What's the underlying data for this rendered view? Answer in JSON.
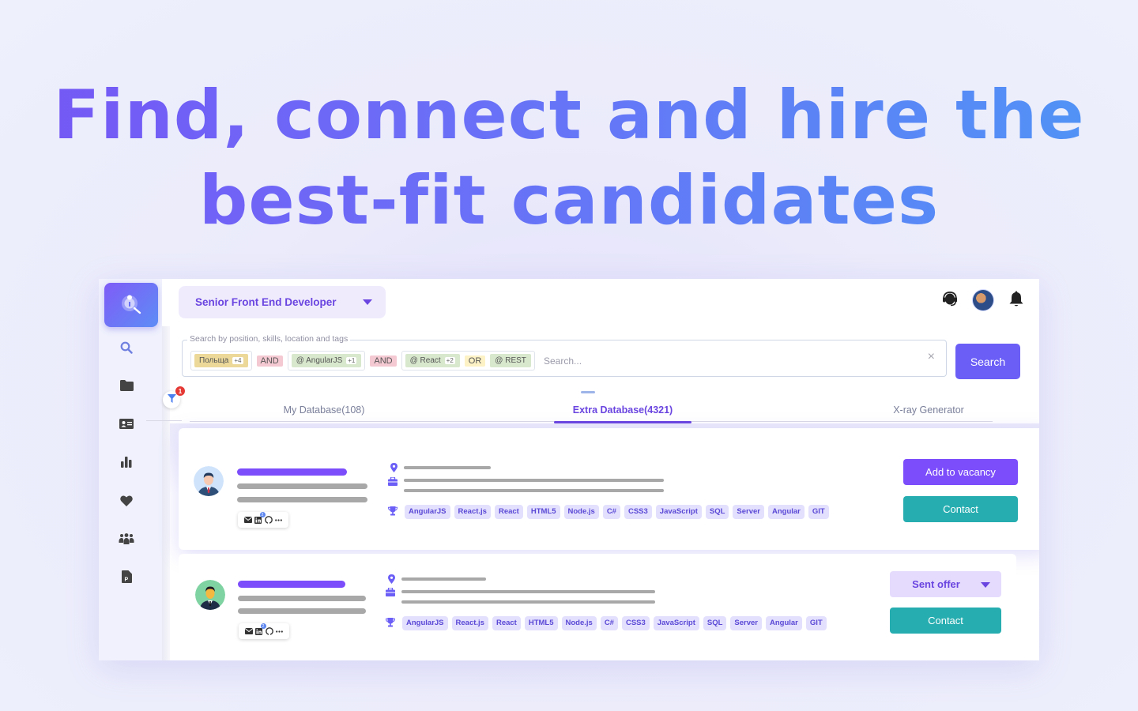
{
  "hero": {
    "line1": "Find, connect and hire the",
    "line2": "best-fit candidates"
  },
  "colors": {
    "accent": "#7c4dfa",
    "search_button": "#6a5ef7",
    "contact_button": "#26adb0",
    "tag_bg": "#e2e0fd"
  },
  "sidebar": {
    "logo_icon": "search-person-icon",
    "items": [
      {
        "name": "search",
        "icon": "search-icon",
        "active": true
      },
      {
        "name": "folders",
        "icon": "folder-icon"
      },
      {
        "name": "contacts",
        "icon": "id-card-icon"
      },
      {
        "name": "analytics",
        "icon": "bar-chart-icon"
      },
      {
        "name": "favorites",
        "icon": "heart-icon"
      },
      {
        "name": "team",
        "icon": "users-icon"
      },
      {
        "name": "documents",
        "icon": "file-p-icon"
      }
    ]
  },
  "topbar": {
    "vacancy": "Senior Front End Developer",
    "icons": [
      "headset-icon",
      "user-avatar",
      "bell-icon"
    ]
  },
  "search": {
    "legend": "Search by position, skills, location and tags",
    "placeholder": "Search...",
    "value": "",
    "button": "Search",
    "clear": "×",
    "groups": [
      {
        "chips": [
          {
            "label": "Польща",
            "count": "+4",
            "type": "location"
          }
        ]
      },
      {
        "operator": "AND"
      },
      {
        "chips": [
          {
            "label": "@ AngularJS",
            "count": "+1",
            "type": "skill"
          }
        ]
      },
      {
        "operator": "AND"
      },
      {
        "chips": [
          {
            "label": "@ React",
            "count": "+2",
            "type": "skill"
          },
          {
            "operator": "OR"
          },
          {
            "label": "@ REST",
            "type": "skill"
          }
        ]
      }
    ],
    "filter_badge": "1"
  },
  "tabs": [
    {
      "label": "My Database(108)",
      "active": false
    },
    {
      "label": "Extra Database(4321)",
      "active": true
    },
    {
      "label": "X-ray Generator",
      "active": false
    }
  ],
  "candidates": [
    {
      "skills": [
        "AngularJS",
        "React.js",
        "React",
        "HTML5",
        "Node.js",
        "C#",
        "CSS3",
        "JavaScript",
        "SQL",
        "Server",
        "Angular",
        "GIT"
      ],
      "linkedin_badge": "2",
      "primary_action": "Add to vacancy",
      "secondary_action": "Contact"
    },
    {
      "skills": [
        "AngularJS",
        "React.js",
        "React",
        "HTML5",
        "Node.js",
        "C#",
        "CSS3",
        "JavaScript",
        "SQL",
        "Server",
        "Angular",
        "GIT"
      ],
      "linkedin_badge": "2",
      "status": "Sent offer",
      "secondary_action": "Contact"
    }
  ]
}
